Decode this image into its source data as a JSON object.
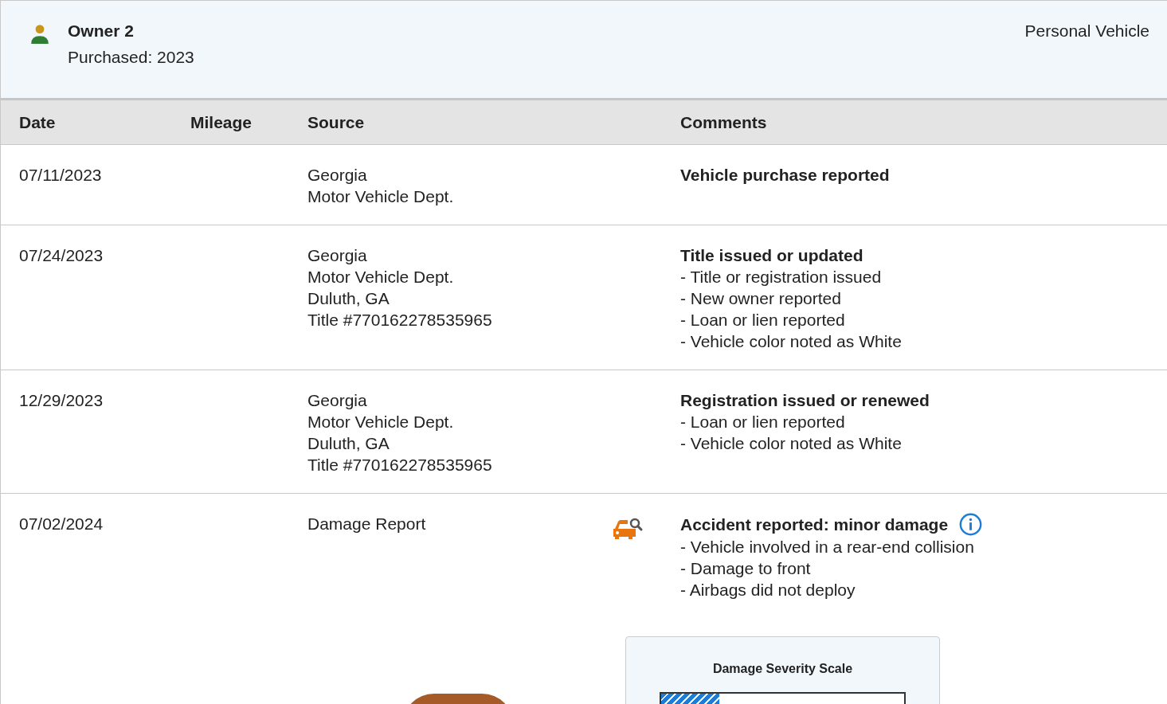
{
  "owner": {
    "name": "Owner 2",
    "purchased": "Purchased: 2023",
    "usage": "Personal Vehicle"
  },
  "table": {
    "columns": [
      "Date",
      "Mileage",
      "Source",
      "Comments"
    ],
    "rows": [
      {
        "kind": "record",
        "date": "07/11/2023",
        "source": [
          "Georgia",
          "Motor Vehicle Dept."
        ],
        "title": "Vehicle purchase reported",
        "info": false,
        "items": []
      },
      {
        "kind": "record",
        "date": "07/24/2023",
        "source": [
          "Georgia",
          "Motor Vehicle Dept.",
          "Duluth, GA",
          "Title #770162278535965"
        ],
        "title": "Title issued or updated",
        "info": false,
        "items": [
          "- Title or registration issued",
          "- New owner reported",
          "- Loan or lien reported",
          "- Vehicle color noted as White"
        ]
      },
      {
        "kind": "record",
        "date": "12/29/2023",
        "source": [
          "Georgia",
          "Motor Vehicle Dept.",
          "Duluth, GA",
          "Title #770162278535965"
        ],
        "title": "Registration issued or renewed",
        "info": false,
        "items": [
          "- Loan or lien reported",
          "- Vehicle color noted as White"
        ]
      },
      {
        "kind": "damage",
        "date": "07/02/2024",
        "source": [
          "Damage Report"
        ],
        "title": "Accident reported: minor damage",
        "info": true,
        "items": [
          "- Vehicle involved in a rear-end collision",
          "- Damage to front",
          "- Airbags did not deploy"
        ],
        "severity_scale": {
          "title": "Damage Severity Scale",
          "level": 0.24
        }
      }
    ]
  }
}
